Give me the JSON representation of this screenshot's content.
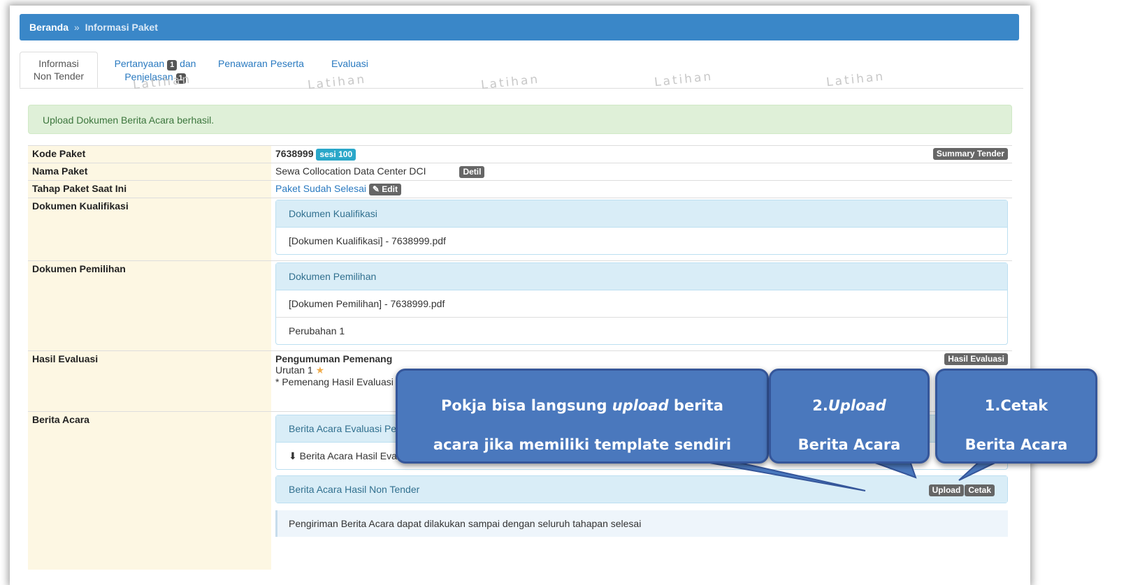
{
  "breadcrumb": {
    "home": "Beranda",
    "separator": "»",
    "current": "Informasi Paket"
  },
  "tabs": [
    {
      "line1": "Informasi",
      "line2": "Non Tender"
    },
    {
      "line1": "Pertanyaan",
      "badge1": "1",
      "line1b": "dan",
      "line2": "Penjelasan",
      "badge2": "1"
    },
    {
      "label": "Penawaran Peserta"
    },
    {
      "label": "Evaluasi"
    }
  ],
  "watermark": "Latihan",
  "alert": "Upload Dokumen Berita Acara berhasil.",
  "rows": {
    "kode": {
      "label": "Kode Paket",
      "value": "7638999",
      "badge": "sesi 100",
      "button": "Summary Tender"
    },
    "nama": {
      "label": "Nama Paket",
      "value": "Sewa Collocation Data Center DCI",
      "button": "Detil"
    },
    "tahap": {
      "label": "Tahap Paket Saat Ini",
      "value": "Paket Sudah Selesai",
      "button": "Edit"
    },
    "kualifikasi": {
      "label": "Dokumen Kualifikasi",
      "panel_title": "Dokumen Kualifikasi",
      "items": [
        "[Dokumen Kualifikasi] - 7638999.pdf"
      ]
    },
    "pemilihan": {
      "label": "Dokumen Pemilihan",
      "panel_title": "Dokumen Pemilihan",
      "items": [
        "[Dokumen Pemilihan] - 7638999.pdf",
        "Perubahan 1"
      ]
    },
    "hasil": {
      "label": "Hasil Evaluasi",
      "title": "Pengumuman Pemenang",
      "button": "Hasil Evaluasi",
      "urutan": "Urutan 1",
      "note": "* Pemenang Hasil Evaluasi"
    },
    "berita": {
      "label": "Berita Acara",
      "panel1_title": "Berita Acara Evaluasi Pe",
      "panel1_item": "Berita Acara Hasil Evaluasi",
      "panel2_title": "Berita Acara Hasil Non Tender",
      "upload": "Upload",
      "cetak": "Cetak",
      "note": "Pengiriman Berita Acara dapat dilakukan sampai dengan seluruh tahapan selesai"
    }
  },
  "callouts": {
    "main_pre": "Pokja bisa langsung ",
    "main_em": "upload",
    "main_post": " berita",
    "main_line2": "acara jika memiliki template sendiri",
    "upload_num": "2.",
    "upload_em": "Upload",
    "upload_line2": "Berita Acara",
    "cetak_line1": "1.Cetak",
    "cetak_line2": "Berita Acara"
  },
  "colors": {
    "header": "#3a87c8",
    "alert_bg": "#dff0d8",
    "panel_head": "#d9edf7",
    "callout": "#4a78bd",
    "label_bg": "#fdf7e3"
  }
}
